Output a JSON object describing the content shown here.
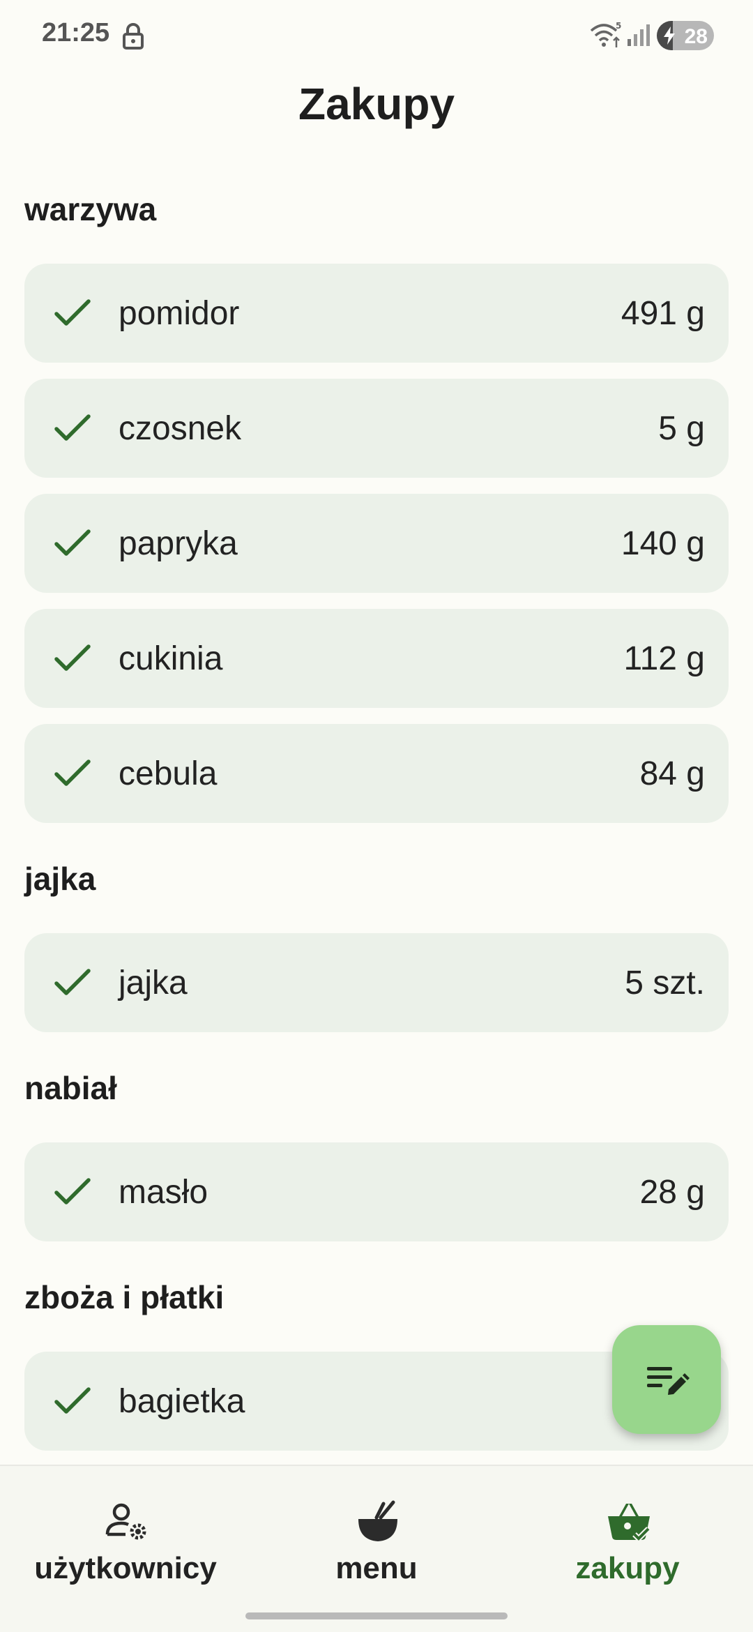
{
  "status": {
    "time": "21:25",
    "battery_text": "28",
    "battery_level": 0.28
  },
  "header": {
    "title": "Zakupy"
  },
  "sections": [
    {
      "title": "warzywa",
      "items": [
        {
          "name": "pomidor",
          "amount": "491 g"
        },
        {
          "name": "czosnek",
          "amount": "5 g"
        },
        {
          "name": "papryka",
          "amount": "140 g"
        },
        {
          "name": "cukinia",
          "amount": "112 g"
        },
        {
          "name": "cebula",
          "amount": "84 g"
        }
      ]
    },
    {
      "title": "jajka",
      "items": [
        {
          "name": "jajka",
          "amount": "5 szt."
        }
      ]
    },
    {
      "title": "nabiał",
      "items": [
        {
          "name": "masło",
          "amount": "28 g"
        }
      ]
    },
    {
      "title": "zboża i płatki",
      "items": [
        {
          "name": "bagietka",
          "amount": ""
        }
      ]
    }
  ],
  "fab": {
    "icon": "edit-list-icon"
  },
  "nav": {
    "users_label": "użytkownicy",
    "menu_label": "menu",
    "shopping_label": "zakupy",
    "active": "zakupy"
  },
  "colors": {
    "accent": "#2f6b2c",
    "item_bg": "#ebf1e9",
    "fab_bg": "#98d68c",
    "background": "#fcfcf7"
  }
}
